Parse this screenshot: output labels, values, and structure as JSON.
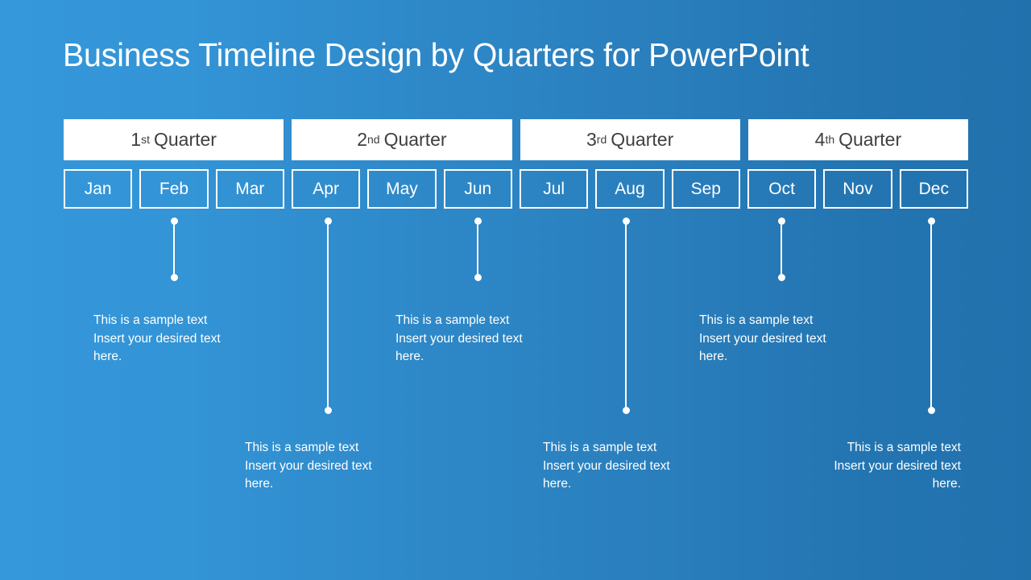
{
  "slide": {
    "title": "Business Timeline Design by Quarters for PowerPoint",
    "background_left_color": "#3498db",
    "background_right_color": "#2171ad"
  },
  "quarters": [
    {
      "number": "1",
      "ordinal": "st",
      "word": "Quarter"
    },
    {
      "number": "2",
      "ordinal": "nd",
      "word": "Quarter"
    },
    {
      "number": "3",
      "ordinal": "rd",
      "word": "Quarter"
    },
    {
      "number": "4",
      "ordinal": "th",
      "word": "Quarter"
    }
  ],
  "months": [
    {
      "label": "Jan"
    },
    {
      "label": "Feb"
    },
    {
      "label": "Mar"
    },
    {
      "label": "Apr"
    },
    {
      "label": "May"
    },
    {
      "label": "Jun"
    },
    {
      "label": "Jul"
    },
    {
      "label": "Aug"
    },
    {
      "label": "Sep"
    },
    {
      "label": "Oct"
    },
    {
      "label": "Nov"
    },
    {
      "label": "Dec"
    }
  ],
  "milestones": [
    {
      "month": "Feb",
      "line1": "This is a sample text",
      "line2": "Insert your desired text",
      "line3": "here.",
      "align": "left"
    },
    {
      "month": "Apr",
      "line1": "This is a sample text",
      "line2": "Insert your desired text",
      "line3": "here.",
      "align": "left"
    },
    {
      "month": "Jun",
      "line1": "This is a sample text",
      "line2": "Insert your desired text",
      "line3": "here.",
      "align": "left"
    },
    {
      "month": "Aug",
      "line1": "This is a sample text",
      "line2": "Insert your desired text",
      "line3": "here.",
      "align": "left"
    },
    {
      "month": "Oct",
      "line1": "This is a sample text",
      "line2": "Insert your desired text",
      "line3": "here.",
      "align": "left"
    },
    {
      "month": "Dec",
      "line1": "This is a sample text",
      "line2": "Insert your desired text",
      "line3": "here.",
      "align": "right"
    }
  ]
}
